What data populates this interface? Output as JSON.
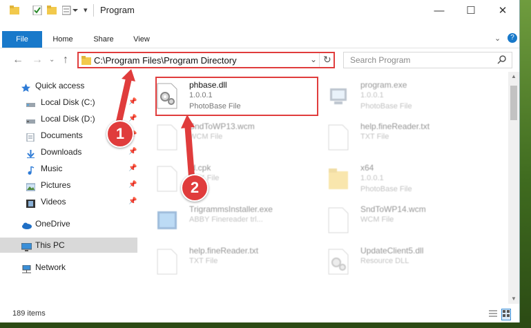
{
  "window": {
    "title": "Program"
  },
  "ribbon": {
    "tabs": [
      "File",
      "Home",
      "Share",
      "View"
    ]
  },
  "address": {
    "path": "C:\\Program Files\\Program Directory"
  },
  "search": {
    "placeholder": "Search Program"
  },
  "sidebar": {
    "items": [
      {
        "label": "Quick access",
        "icon": "star-icon",
        "pinned": false
      },
      {
        "label": "Local Disk (C:)",
        "icon": "drive-icon",
        "pinned": true
      },
      {
        "label": "Local Disk (D:)",
        "icon": "drive-icon",
        "pinned": true
      },
      {
        "label": "Documents",
        "icon": "documents-icon",
        "pinned": true
      },
      {
        "label": "Downloads",
        "icon": "download-icon",
        "pinned": true
      },
      {
        "label": "Music",
        "icon": "music-icon",
        "pinned": true
      },
      {
        "label": "Pictures",
        "icon": "pictures-icon",
        "pinned": true
      },
      {
        "label": "Videos",
        "icon": "videos-icon",
        "pinned": true
      },
      {
        "label": "OneDrive",
        "icon": "cloud-icon",
        "pinned": false
      },
      {
        "label": "This PC",
        "icon": "computer-icon",
        "pinned": false,
        "selected": true
      },
      {
        "label": "Network",
        "icon": "network-icon",
        "pinned": false
      }
    ]
  },
  "files": [
    {
      "name": "phbase.dll",
      "line1": "1.0.0.1",
      "line2": "PhotoBase File",
      "icon": "dll-gear-icon",
      "highlighted": true
    },
    {
      "name": "program.exe",
      "line1": "1.0.0.1",
      "line2": "PhotoBase File",
      "icon": "exe-icon"
    },
    {
      "name": "SndToWP13.wcm",
      "line1": "WCM File",
      "line2": "",
      "icon": "blank-file-icon"
    },
    {
      "name": "help.fineReader.txt",
      "line1": "TXT File",
      "line2": "",
      "icon": "blank-file-icon"
    },
    {
      "name": "ld.cpk",
      "line1": "CPK File",
      "line2": "",
      "icon": "blank-file-icon"
    },
    {
      "name": "x64",
      "line1": "1.0.0.1",
      "line2": "PhotoBase File",
      "icon": "folder-icon"
    },
    {
      "name": "TrigrammsInstaller.exe",
      "line1": "ABBY Finereader trl...",
      "line2": "",
      "icon": "installer-icon"
    },
    {
      "name": "SndToWP14.wcm",
      "line1": "WCM File",
      "line2": "",
      "icon": "blank-file-icon"
    },
    {
      "name": "help.fineReader.txt",
      "line1": "TXT File",
      "line2": "",
      "icon": "blank-file-icon"
    },
    {
      "name": "UpdateClient5.dll",
      "line1": "Resource DLL",
      "line2": "",
      "icon": "dll-gear-icon"
    }
  ],
  "status": {
    "count": "189 items"
  },
  "annotations": {
    "step1": "1",
    "step2": "2"
  },
  "colors": {
    "accent": "#1979ca",
    "highlight": "#e03c3c"
  }
}
